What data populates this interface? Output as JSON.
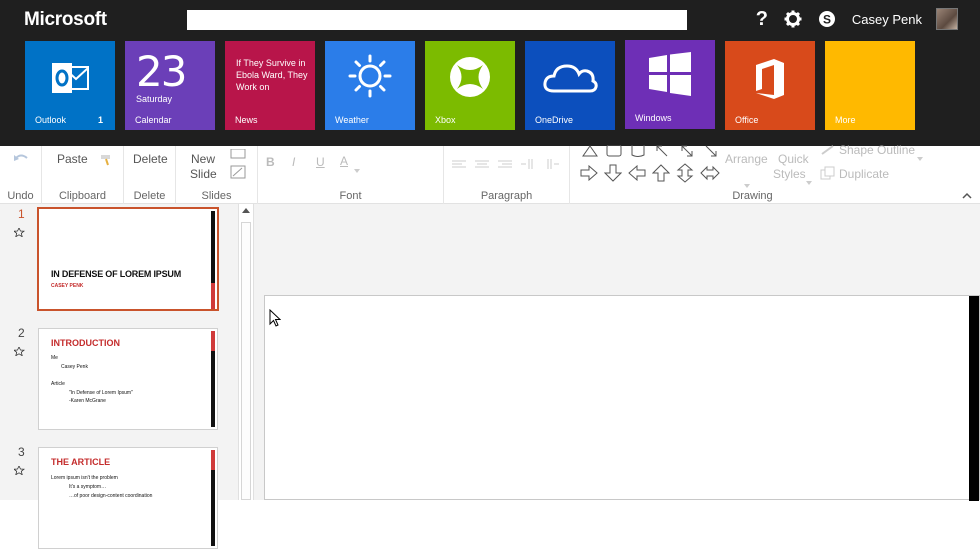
{
  "header": {
    "brand": "Microsoft",
    "user_name": "Casey Penk",
    "icons": [
      "help-icon",
      "settings-gear-icon",
      "skype-icon"
    ]
  },
  "tiles": [
    {
      "id": "outlook",
      "label": "Outlook",
      "count": "1",
      "color": "#0072c6",
      "icon": "outlook-icon"
    },
    {
      "id": "calendar",
      "label": "Calendar",
      "number": "23",
      "day": "Saturday",
      "color": "#6b3fb8"
    },
    {
      "id": "news",
      "label": "News",
      "headline": "If They Survive in Ebola Ward, They Work on",
      "color": "#b8154a"
    },
    {
      "id": "weather",
      "label": "Weather",
      "color": "#2b7de9",
      "icon": "sun-icon"
    },
    {
      "id": "xbox",
      "label": "Xbox",
      "color": "#7cbb00",
      "icon": "xbox-icon"
    },
    {
      "id": "onedrive",
      "label": "OneDrive",
      "color": "#0c4fbd",
      "icon": "cloud-icon"
    },
    {
      "id": "windows",
      "label": "Windows",
      "color": "#6e2fb6",
      "icon": "windows-logo-icon"
    },
    {
      "id": "office",
      "label": "Office",
      "color": "#d84a1b",
      "icon": "office-icon"
    },
    {
      "id": "more",
      "label": "More",
      "color": "#ffb900"
    }
  ],
  "ribbon": {
    "groups": {
      "undo": "Undo",
      "clipboard": "Clipboard",
      "delete": "Delete",
      "slides": "Slides",
      "font": "Font",
      "paragraph": "Paragraph",
      "drawing": "Drawing"
    },
    "buttons": {
      "paste": "Paste",
      "delete": "Delete",
      "new": "New",
      "slide": "Slide",
      "arrange": "Arrange",
      "quick": "Quick",
      "styles": "Styles",
      "shape_outline": "Shape Outline",
      "duplicate": "Duplicate",
      "bold": "B",
      "italic": "I",
      "underline": "U",
      "font_color": "A"
    }
  },
  "slides": [
    {
      "number": "1",
      "title": "IN DEFENSE OF LOREM IPSUM",
      "subtitle": "CASEY PENK"
    },
    {
      "number": "2",
      "title": "INTRODUCTION",
      "lines": [
        "Me",
        "Casey Penk",
        "Article",
        "\"In Defense of Lorem Ipsum\"",
        "-Karen McGrane"
      ]
    },
    {
      "number": "3",
      "title": "THE ARTICLE",
      "lines": [
        "Lorem ipsum isn't the problem",
        "It's a symptom…",
        "…of poor design-content coordination"
      ]
    }
  ],
  "theme": {
    "selection": "#c9532c",
    "accent_red": "#c42c2c"
  }
}
